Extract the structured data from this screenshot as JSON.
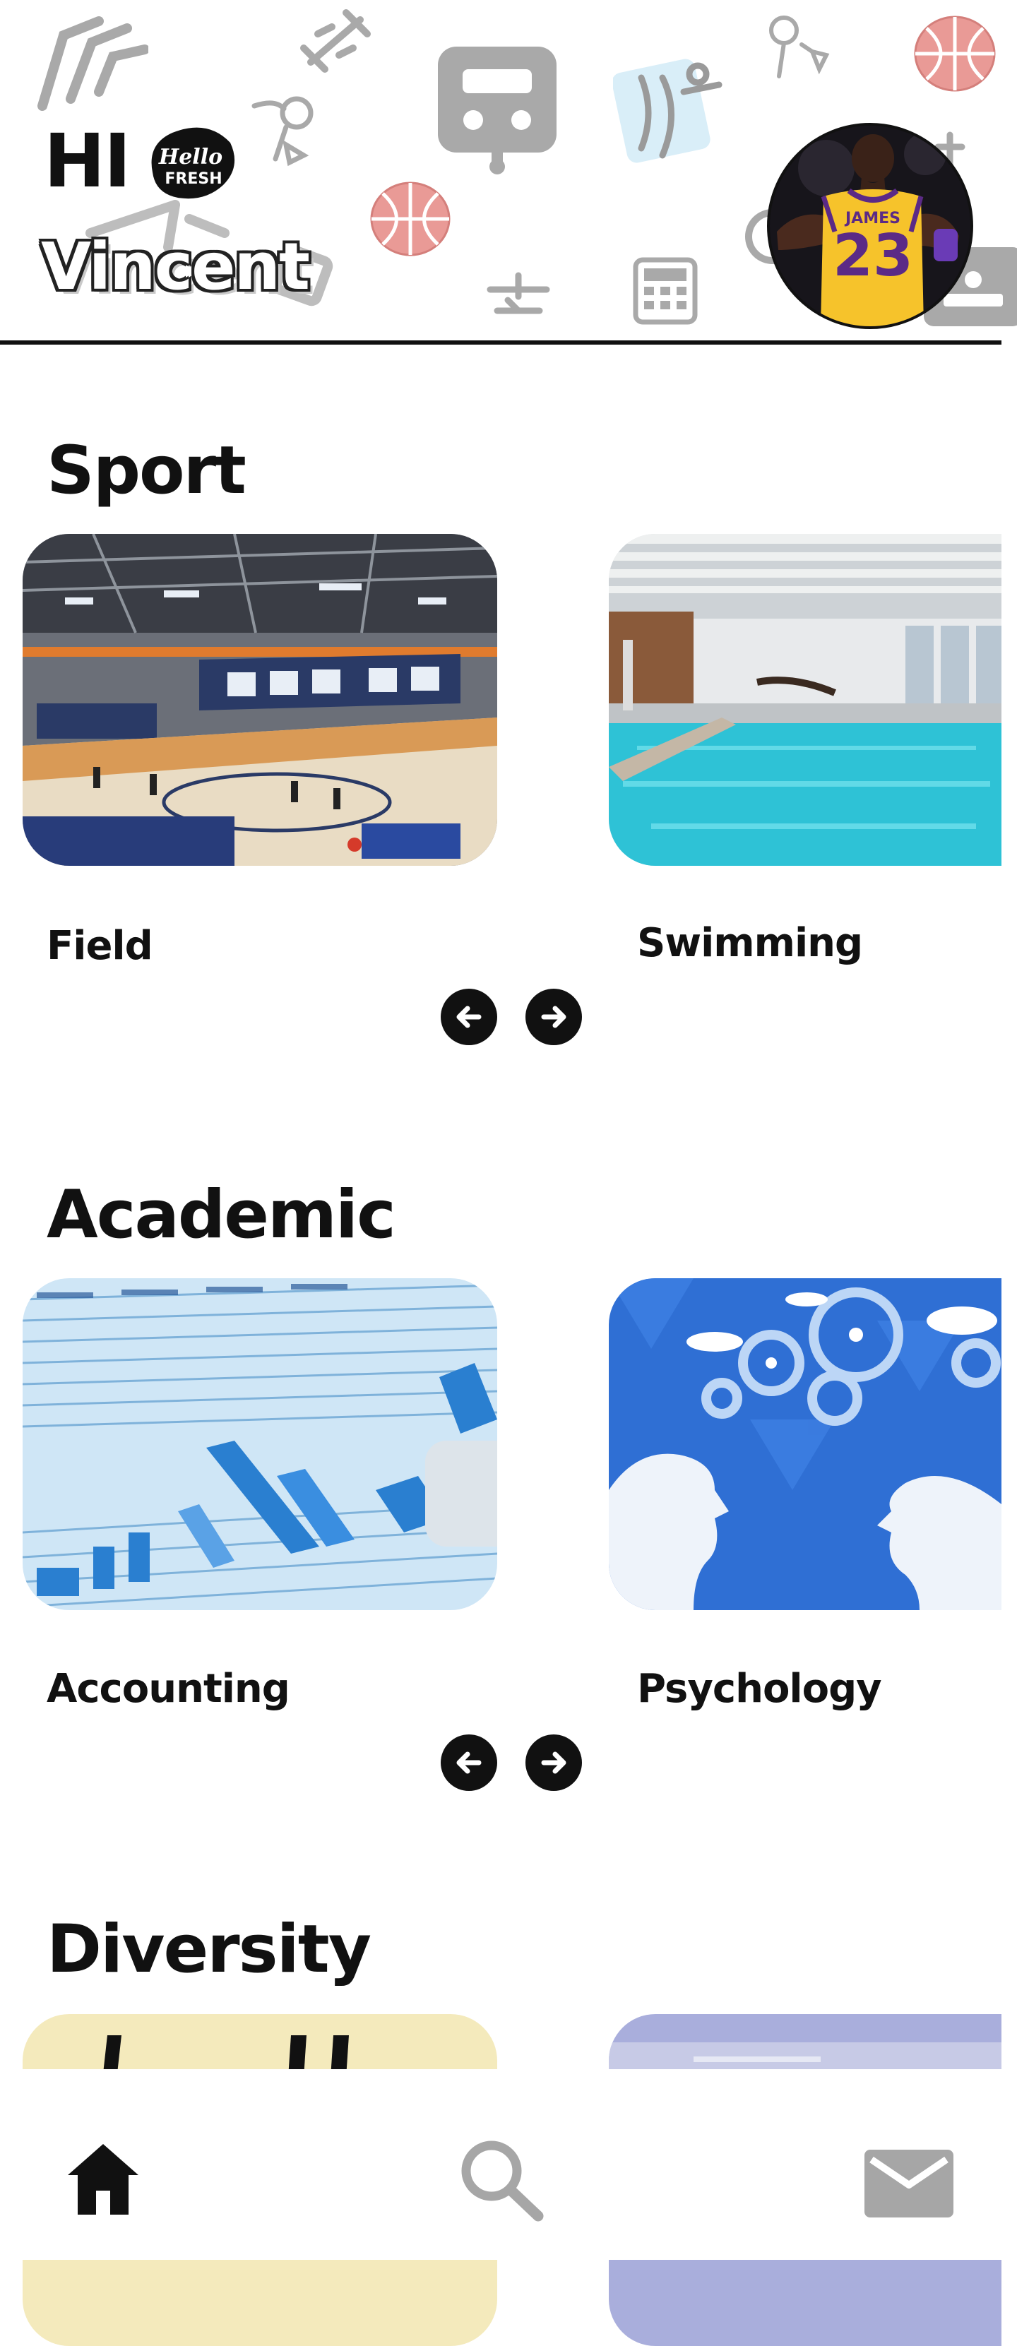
{
  "header": {
    "greeting": "HI",
    "user_name": "Vincent",
    "brand_line1": "Hello",
    "brand_line2": "FRESH",
    "avatar_jersey_name": "JAMES",
    "avatar_jersey_number": "23"
  },
  "sections": [
    {
      "title": "Sport",
      "cards": [
        {
          "label": "Field",
          "image": "indoor-court-photo"
        },
        {
          "label": "Swimming",
          "image": "indoor-pool-photo"
        }
      ]
    },
    {
      "title": "Academic",
      "cards": [
        {
          "label": "Accounting",
          "image": "spreadsheet-chart-photo"
        },
        {
          "label": "Psychology",
          "image": "gear-heads-illustration"
        }
      ]
    },
    {
      "title": "Diversity",
      "cards": [
        {
          "label": "",
          "image": "cream-sign-photo"
        },
        {
          "label": "",
          "image": "lavender-room-photo"
        }
      ]
    }
  ],
  "bottom_nav": [
    {
      "icon": "home-icon",
      "active": true
    },
    {
      "icon": "search-icon",
      "active": false
    },
    {
      "icon": "mail-icon",
      "active": false
    }
  ],
  "colors": {
    "ink": "#111111",
    "decor_gray": "#a9a9a9",
    "ball_pink": "#e99a96",
    "jersey_gold": "#f6c32b",
    "jersey_purple": "#5b2a86",
    "pool_cyan": "#2ec2d6",
    "accounting_blue": "#2a7fd0",
    "psych_blue": "#2f6fd4",
    "nav_inactive": "#a6a6a6"
  }
}
